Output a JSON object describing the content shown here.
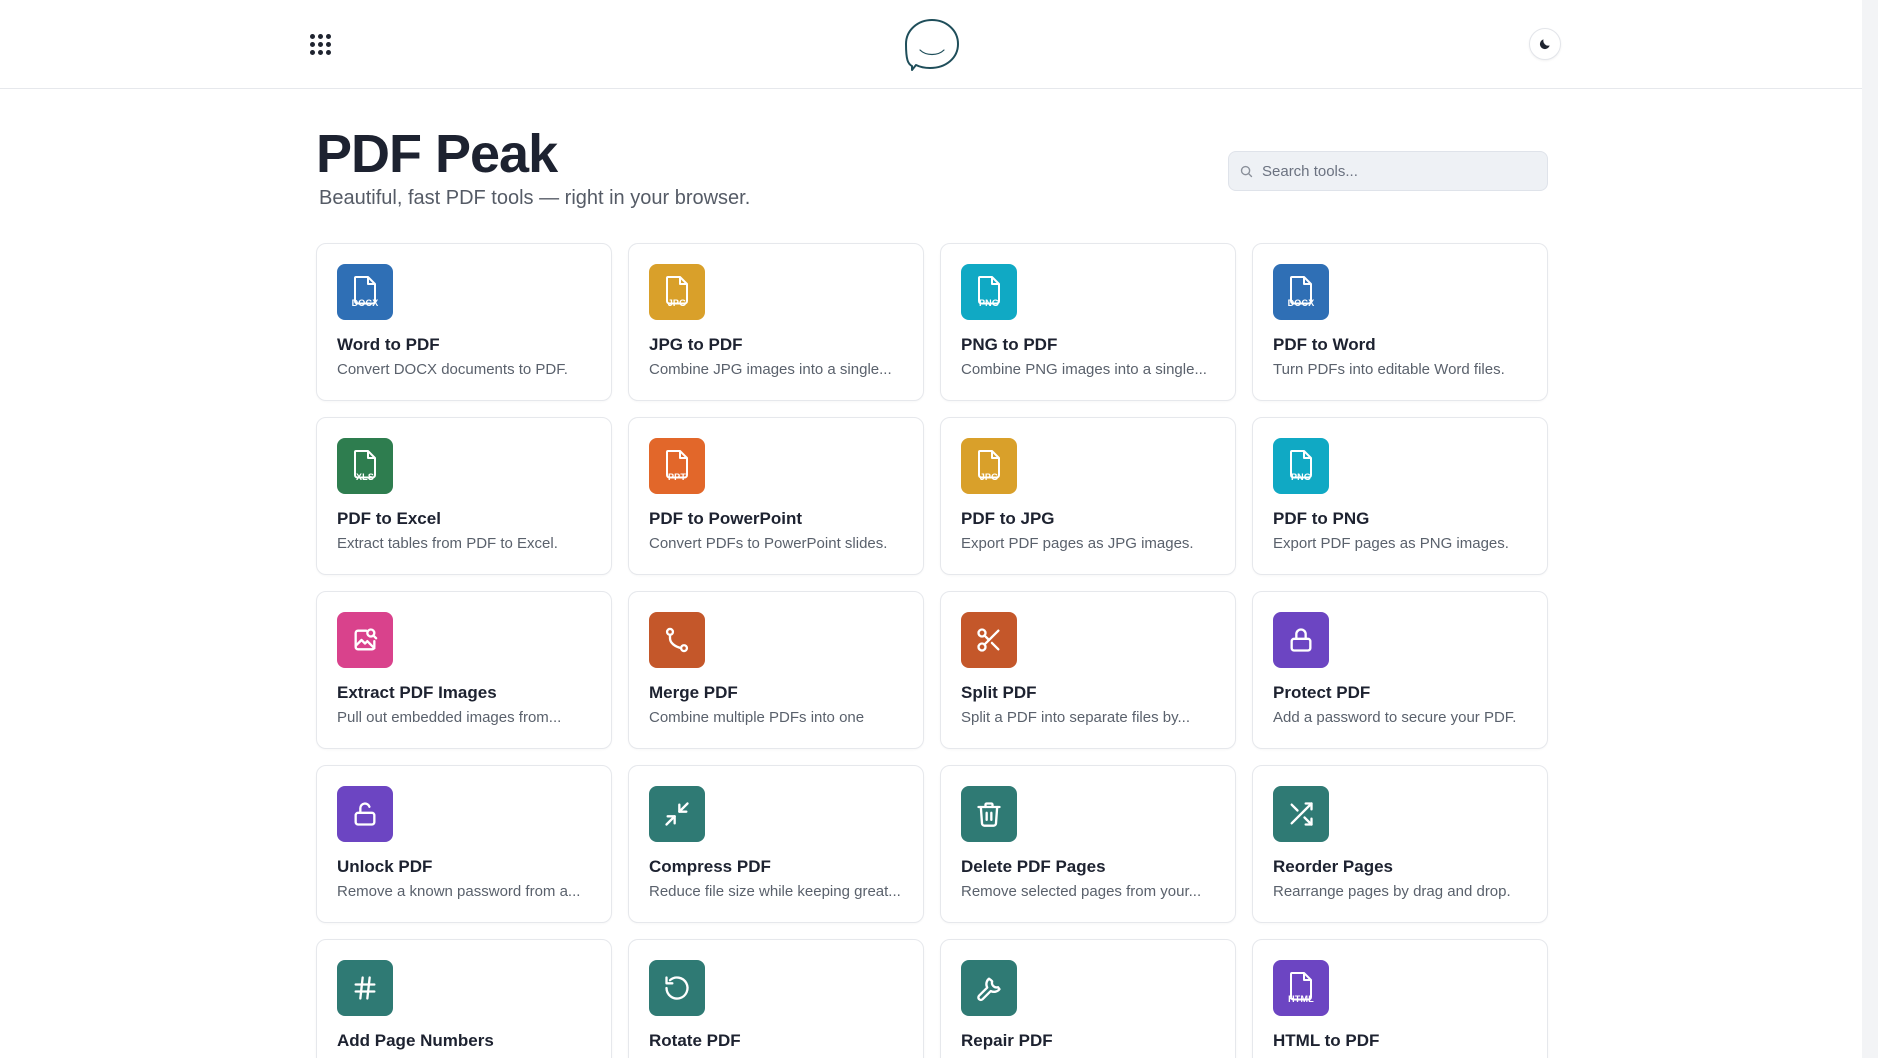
{
  "header": {
    "apps_icon": "grid-icon",
    "logo_icon": "chat-bubble-logo",
    "theme_icon": "moon-icon"
  },
  "hero": {
    "title": "PDF Peak",
    "subtitle": "Beautiful, fast PDF tools — right in your browser."
  },
  "search": {
    "placeholder": "Search tools..."
  },
  "tools": [
    {
      "name": "Word to PDF",
      "desc": "Convert DOCX documents to PDF.",
      "icon": "file-icon",
      "badge": "DOCX",
      "color": "#2f6fb5"
    },
    {
      "name": "JPG to PDF",
      "desc": "Combine JPG images into a single...",
      "icon": "file-icon",
      "badge": "JPG",
      "color": "#d9a02a"
    },
    {
      "name": "PNG to PDF",
      "desc": "Combine PNG images into a single...",
      "icon": "file-icon",
      "badge": "PNG",
      "color": "#10a9c4"
    },
    {
      "name": "PDF to Word",
      "desc": "Turn PDFs into editable Word files.",
      "icon": "file-icon",
      "badge": "DOCX",
      "color": "#2f6fb5"
    },
    {
      "name": "PDF to Excel",
      "desc": "Extract tables from PDF to Excel.",
      "icon": "file-icon",
      "badge": "XLS",
      "color": "#2e7d4f"
    },
    {
      "name": "PDF to PowerPoint",
      "desc": "Convert PDFs to PowerPoint slides.",
      "icon": "file-icon",
      "badge": "PPT",
      "color": "#e2672a"
    },
    {
      "name": "PDF to JPG",
      "desc": "Export PDF pages as JPG images.",
      "icon": "file-icon",
      "badge": "JPG",
      "color": "#d9a02a"
    },
    {
      "name": "PDF to PNG",
      "desc": "Export PDF pages as PNG images.",
      "icon": "file-icon",
      "badge": "PNG",
      "color": "#10a9c4"
    },
    {
      "name": "Extract PDF Images",
      "desc": "Pull out embedded images from...",
      "icon": "image-search-icon",
      "badge": "",
      "color": "#d9428c"
    },
    {
      "name": "Merge PDF",
      "desc": "Combine multiple PDFs into one",
      "icon": "merge-icon",
      "badge": "",
      "color": "#c4572a"
    },
    {
      "name": "Split PDF",
      "desc": "Split a PDF into separate files by...",
      "icon": "scissors-icon",
      "badge": "",
      "color": "#c4572a"
    },
    {
      "name": "Protect PDF",
      "desc": "Add a password to secure your PDF.",
      "icon": "lock-icon",
      "badge": "",
      "color": "#6c45c2"
    },
    {
      "name": "Unlock PDF",
      "desc": "Remove a known password from a...",
      "icon": "unlock-icon",
      "badge": "",
      "color": "#6c45c2"
    },
    {
      "name": "Compress PDF",
      "desc": "Reduce file size while keeping great...",
      "icon": "compress-icon",
      "badge": "",
      "color": "#2f7a74"
    },
    {
      "name": "Delete PDF Pages",
      "desc": "Remove selected pages from your...",
      "icon": "trash-icon",
      "badge": "",
      "color": "#2f7a74"
    },
    {
      "name": "Reorder Pages",
      "desc": "Rearrange pages by drag and drop.",
      "icon": "shuffle-icon",
      "badge": "",
      "color": "#2f7a74"
    },
    {
      "name": "Add Page Numbers",
      "desc": "",
      "icon": "hash-icon",
      "badge": "",
      "color": "#2f7a74"
    },
    {
      "name": "Rotate PDF",
      "desc": "",
      "icon": "rotate-icon",
      "badge": "",
      "color": "#2f7a74"
    },
    {
      "name": "Repair PDF",
      "desc": "",
      "icon": "wrench-icon",
      "badge": "",
      "color": "#2f7a74"
    },
    {
      "name": "HTML to PDF",
      "desc": "",
      "icon": "file-icon",
      "badge": "HTML",
      "color": "#6c45c2"
    }
  ]
}
